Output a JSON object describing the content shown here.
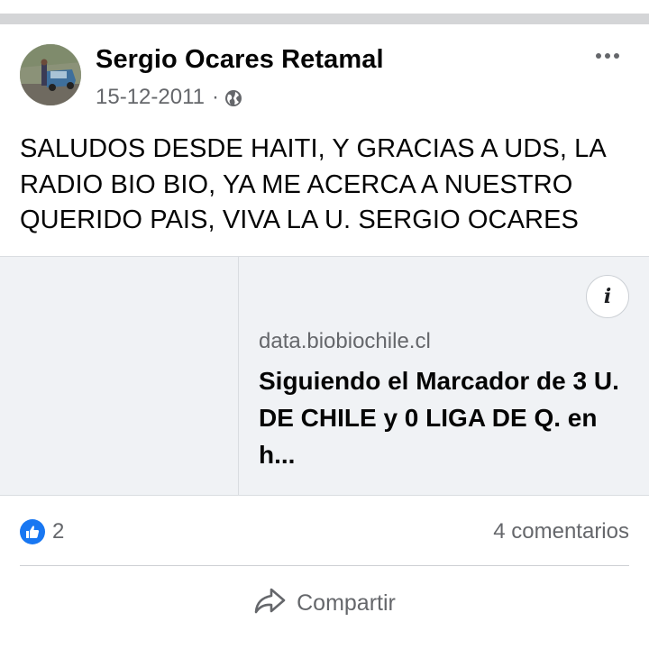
{
  "post": {
    "author": "Sergio Ocares Retamal",
    "date": "15-12-2011",
    "separator": "·",
    "privacy_icon": "globe-icon",
    "more_icon": "more-options-icon",
    "text": "SALUDOS DESDE HAITI, Y GRACIAS A UDS, LA RADIO BIO BIO, YA ME ACERCA A NUESTRO QUERIDO PAIS, VIVA LA U. SERGIO OCARES"
  },
  "link": {
    "domain": "data.biobiochile.cl",
    "title": "Siguiendo el Marcador de 3 U. DE CHILE y 0 LIGA DE Q. en h...",
    "info_label": "i"
  },
  "stats": {
    "reaction_icon": "like-icon",
    "likes": "2",
    "comments": "4 comentarios"
  },
  "actions": {
    "share_label": "Compartir",
    "share_icon": "share-arrow-icon"
  },
  "colors": {
    "like_blue": "#1877f2",
    "secondary_text": "#65676b",
    "card_bg": "#f0f2f5"
  }
}
